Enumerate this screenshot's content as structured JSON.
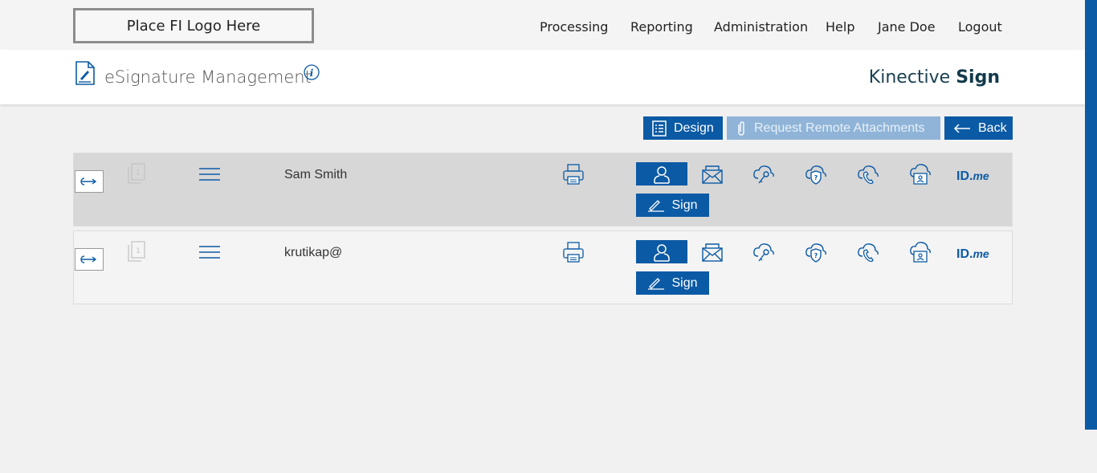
{
  "logo": {
    "text": "Place FI Logo Here"
  },
  "nav": [
    "Processing",
    "Reporting",
    "Administration",
    "Help",
    "Jane Doe",
    "Logout"
  ],
  "header": {
    "title": "eSignature Management",
    "brand_light": "Kinective",
    "brand_bold": "Sign"
  },
  "toolbar": {
    "design": "Design",
    "request_attachments": "Request Remote Attachments",
    "back": "Back"
  },
  "signers": [
    {
      "name": "Sam Smith",
      "sign_label": "Sign",
      "idme_bold": "ID.",
      "idme_italic": "me"
    },
    {
      "name": "krutikap@",
      "sign_label": "Sign",
      "idme_bold": "ID.",
      "idme_italic": "me"
    }
  ],
  "colors": {
    "accent": "#0b5aa5",
    "disabled": "#8fb4d8",
    "row_selected": "#d7d7d7",
    "brand": "#123a4c"
  }
}
